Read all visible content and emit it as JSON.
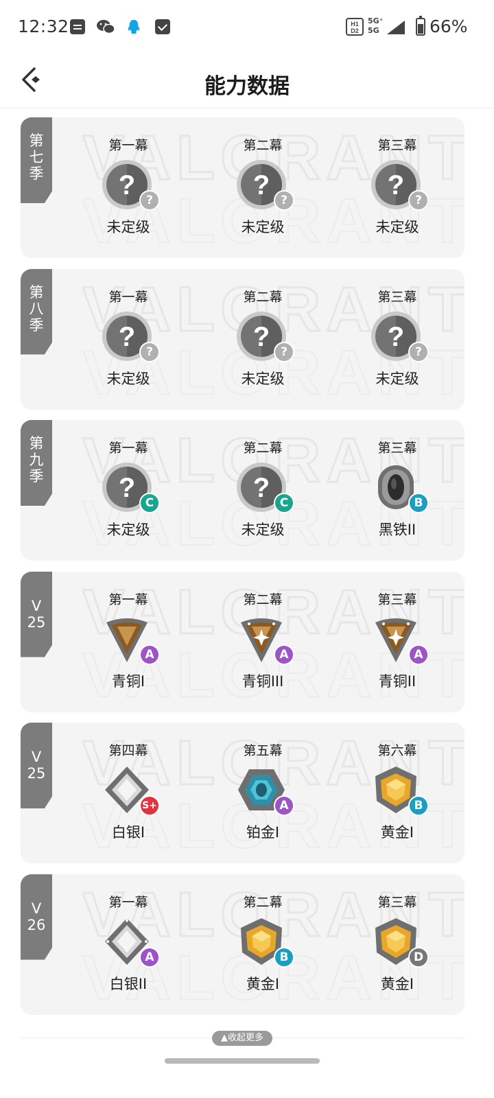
{
  "status_bar": {
    "time": "12:32",
    "network_top": "5G⁺",
    "network_bottom": "5G",
    "battery": "66%",
    "icons": [
      "message-icon",
      "wechat-icon",
      "qq-icon",
      "mail-icon",
      "hd-icon",
      "signal-icon",
      "battery-icon"
    ]
  },
  "header": {
    "title": "能力数据",
    "back_icon": "back-chevron-icon"
  },
  "grade_colors": {
    "?": "#b0b0b0",
    "C": "#1aa68e",
    "B": "#1a9fc1",
    "A": "#9d54c8",
    "S+": "#e0353f",
    "D": "#777777"
  },
  "seasons": [
    {
      "tag": "第\n七\n季",
      "acts": [
        {
          "label": "第一幕",
          "rank": "未定级",
          "grade": "?",
          "badge": "unranked"
        },
        {
          "label": "第二幕",
          "rank": "未定级",
          "grade": "?",
          "badge": "unranked"
        },
        {
          "label": "第三幕",
          "rank": "未定级",
          "grade": "?",
          "badge": "unranked"
        }
      ]
    },
    {
      "tag": "第\n八\n季",
      "acts": [
        {
          "label": "第一幕",
          "rank": "未定级",
          "grade": "?",
          "badge": "unranked"
        },
        {
          "label": "第二幕",
          "rank": "未定级",
          "grade": "?",
          "badge": "unranked"
        },
        {
          "label": "第三幕",
          "rank": "未定级",
          "grade": "?",
          "badge": "unranked"
        }
      ]
    },
    {
      "tag": "第\n九\n季",
      "acts": [
        {
          "label": "第一幕",
          "rank": "未定级",
          "grade": "C",
          "badge": "unranked"
        },
        {
          "label": "第二幕",
          "rank": "未定级",
          "grade": "C",
          "badge": "unranked"
        },
        {
          "label": "第三幕",
          "rank": "黑铁II",
          "grade": "B",
          "badge": "iron"
        }
      ]
    },
    {
      "tag": "V\n25",
      "acts": [
        {
          "label": "第一幕",
          "rank": "青铜I",
          "grade": "A",
          "badge": "bronze"
        },
        {
          "label": "第二幕",
          "rank": "青铜III",
          "grade": "A",
          "badge": "bronze-star"
        },
        {
          "label": "第三幕",
          "rank": "青铜II",
          "grade": "A",
          "badge": "bronze-star"
        }
      ]
    },
    {
      "tag": "V\n25",
      "acts": [
        {
          "label": "第四幕",
          "rank": "白银I",
          "grade": "S+",
          "badge": "silver"
        },
        {
          "label": "第五幕",
          "rank": "铂金I",
          "grade": "A",
          "badge": "platinum"
        },
        {
          "label": "第六幕",
          "rank": "黄金I",
          "grade": "B",
          "badge": "gold"
        }
      ]
    },
    {
      "tag": "V\n26",
      "acts": [
        {
          "label": "第一幕",
          "rank": "白银II",
          "grade": "A",
          "badge": "silver-star"
        },
        {
          "label": "第二幕",
          "rank": "黄金I",
          "grade": "B",
          "badge": "gold"
        },
        {
          "label": "第三幕",
          "rank": "黄金I",
          "grade": "D",
          "badge": "gold"
        }
      ]
    }
  ],
  "footer": {
    "collapse_label": "▲收起更多"
  }
}
